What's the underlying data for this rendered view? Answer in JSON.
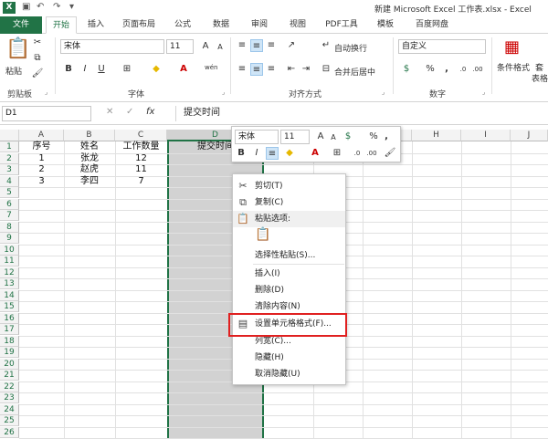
{
  "title": "新建 Microsoft Excel 工作表.xlsx - Excel",
  "app_icon": "X",
  "tabs": [
    "文件",
    "开始",
    "插入",
    "页面布局",
    "公式",
    "数据",
    "审阅",
    "视图",
    "PDF工具",
    "模板",
    "百度网盘"
  ],
  "ribbon": {
    "clipboard": {
      "paste": "粘贴",
      "label": "剪贴板"
    },
    "font": {
      "name": "宋体",
      "size": "11",
      "bold": "B",
      "italic": "I",
      "underline": "U",
      "grow": "A",
      "shrink": "A",
      "label": "字体",
      "wen": "wén"
    },
    "align": {
      "wrap": "自动换行",
      "merge": "合并后居中",
      "label": "对齐方式"
    },
    "number": {
      "format": "自定义",
      "percent": "%",
      "comma": ",",
      "label": "数字"
    },
    "styles": {
      "conditional": "条件格式",
      "cut1": "套",
      "cut2": "表格"
    }
  },
  "formula_bar": {
    "name_box": "D1",
    "fx": "fx",
    "content": "提交时间"
  },
  "columns": [
    "A",
    "B",
    "C",
    "D",
    "E",
    "F",
    "G",
    "H",
    "I",
    "J"
  ],
  "rows": [
    "1",
    "2",
    "3",
    "4",
    "5",
    "6",
    "7",
    "8",
    "9",
    "10",
    "11",
    "12",
    "13",
    "14",
    "15",
    "16",
    "17",
    "18",
    "19",
    "20",
    "21",
    "22",
    "23",
    "24",
    "25",
    "26"
  ],
  "cells": {
    "A1": "序号",
    "B1": "姓名",
    "C1": "工作数量",
    "D1": "提交时间",
    "A2": "1",
    "B2": "张龙",
    "C2": "12",
    "A3": "2",
    "B3": "赵虎",
    "C3": "11",
    "A4": "3",
    "B4": "李四",
    "C4": "7"
  },
  "mini_toolbar": {
    "font": "宋体",
    "size": "11",
    "bold": "B",
    "italic": "I",
    "percent": "%",
    "comma": ","
  },
  "context_menu": [
    {
      "label": "剪切(T)",
      "icon": "scissors-icon"
    },
    {
      "label": "复制(C)",
      "icon": "copy-icon"
    },
    {
      "label": "粘贴选项:",
      "icon": "paste-icon"
    },
    {
      "label": "",
      "icon": "paste-option-icon"
    },
    {
      "label": "选择性粘贴(S)...",
      "icon": ""
    },
    {
      "label": "插入(I)",
      "icon": ""
    },
    {
      "label": "删除(D)",
      "icon": ""
    },
    {
      "label": "清除内容(N)",
      "icon": ""
    },
    {
      "label": "设置单元格格式(F)...",
      "icon": "format-cells-icon"
    },
    {
      "label": "列宽(C)...",
      "icon": ""
    },
    {
      "label": "隐藏(H)",
      "icon": ""
    },
    {
      "label": "取消隐藏(U)",
      "icon": ""
    }
  ],
  "colors": {
    "accent": "#217346",
    "highlight_box": "#e02020",
    "selection": "#d2d2d2"
  }
}
